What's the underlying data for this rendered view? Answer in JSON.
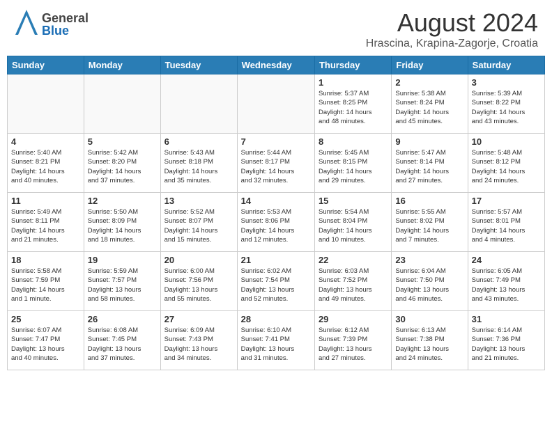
{
  "header": {
    "logo": {
      "general": "General",
      "blue": "Blue"
    },
    "title": "August 2024",
    "subtitle": "Hrascina, Krapina-Zagorje, Croatia"
  },
  "calendar": {
    "headers": [
      "Sunday",
      "Monday",
      "Tuesday",
      "Wednesday",
      "Thursday",
      "Friday",
      "Saturday"
    ],
    "rows": [
      [
        {
          "day": "",
          "info": "",
          "empty": true
        },
        {
          "day": "",
          "info": "",
          "empty": true
        },
        {
          "day": "",
          "info": "",
          "empty": true
        },
        {
          "day": "",
          "info": "",
          "empty": true
        },
        {
          "day": "1",
          "info": "Sunrise: 5:37 AM\nSunset: 8:25 PM\nDaylight: 14 hours\nand 48 minutes."
        },
        {
          "day": "2",
          "info": "Sunrise: 5:38 AM\nSunset: 8:24 PM\nDaylight: 14 hours\nand 45 minutes."
        },
        {
          "day": "3",
          "info": "Sunrise: 5:39 AM\nSunset: 8:22 PM\nDaylight: 14 hours\nand 43 minutes."
        }
      ],
      [
        {
          "day": "4",
          "info": "Sunrise: 5:40 AM\nSunset: 8:21 PM\nDaylight: 14 hours\nand 40 minutes."
        },
        {
          "day": "5",
          "info": "Sunrise: 5:42 AM\nSunset: 8:20 PM\nDaylight: 14 hours\nand 37 minutes."
        },
        {
          "day": "6",
          "info": "Sunrise: 5:43 AM\nSunset: 8:18 PM\nDaylight: 14 hours\nand 35 minutes."
        },
        {
          "day": "7",
          "info": "Sunrise: 5:44 AM\nSunset: 8:17 PM\nDaylight: 14 hours\nand 32 minutes."
        },
        {
          "day": "8",
          "info": "Sunrise: 5:45 AM\nSunset: 8:15 PM\nDaylight: 14 hours\nand 29 minutes."
        },
        {
          "day": "9",
          "info": "Sunrise: 5:47 AM\nSunset: 8:14 PM\nDaylight: 14 hours\nand 27 minutes."
        },
        {
          "day": "10",
          "info": "Sunrise: 5:48 AM\nSunset: 8:12 PM\nDaylight: 14 hours\nand 24 minutes."
        }
      ],
      [
        {
          "day": "11",
          "info": "Sunrise: 5:49 AM\nSunset: 8:11 PM\nDaylight: 14 hours\nand 21 minutes."
        },
        {
          "day": "12",
          "info": "Sunrise: 5:50 AM\nSunset: 8:09 PM\nDaylight: 14 hours\nand 18 minutes."
        },
        {
          "day": "13",
          "info": "Sunrise: 5:52 AM\nSunset: 8:07 PM\nDaylight: 14 hours\nand 15 minutes."
        },
        {
          "day": "14",
          "info": "Sunrise: 5:53 AM\nSunset: 8:06 PM\nDaylight: 14 hours\nand 12 minutes."
        },
        {
          "day": "15",
          "info": "Sunrise: 5:54 AM\nSunset: 8:04 PM\nDaylight: 14 hours\nand 10 minutes."
        },
        {
          "day": "16",
          "info": "Sunrise: 5:55 AM\nSunset: 8:02 PM\nDaylight: 14 hours\nand 7 minutes."
        },
        {
          "day": "17",
          "info": "Sunrise: 5:57 AM\nSunset: 8:01 PM\nDaylight: 14 hours\nand 4 minutes."
        }
      ],
      [
        {
          "day": "18",
          "info": "Sunrise: 5:58 AM\nSunset: 7:59 PM\nDaylight: 14 hours\nand 1 minute."
        },
        {
          "day": "19",
          "info": "Sunrise: 5:59 AM\nSunset: 7:57 PM\nDaylight: 13 hours\nand 58 minutes."
        },
        {
          "day": "20",
          "info": "Sunrise: 6:00 AM\nSunset: 7:56 PM\nDaylight: 13 hours\nand 55 minutes."
        },
        {
          "day": "21",
          "info": "Sunrise: 6:02 AM\nSunset: 7:54 PM\nDaylight: 13 hours\nand 52 minutes."
        },
        {
          "day": "22",
          "info": "Sunrise: 6:03 AM\nSunset: 7:52 PM\nDaylight: 13 hours\nand 49 minutes."
        },
        {
          "day": "23",
          "info": "Sunrise: 6:04 AM\nSunset: 7:50 PM\nDaylight: 13 hours\nand 46 minutes."
        },
        {
          "day": "24",
          "info": "Sunrise: 6:05 AM\nSunset: 7:49 PM\nDaylight: 13 hours\nand 43 minutes."
        }
      ],
      [
        {
          "day": "25",
          "info": "Sunrise: 6:07 AM\nSunset: 7:47 PM\nDaylight: 13 hours\nand 40 minutes."
        },
        {
          "day": "26",
          "info": "Sunrise: 6:08 AM\nSunset: 7:45 PM\nDaylight: 13 hours\nand 37 minutes."
        },
        {
          "day": "27",
          "info": "Sunrise: 6:09 AM\nSunset: 7:43 PM\nDaylight: 13 hours\nand 34 minutes."
        },
        {
          "day": "28",
          "info": "Sunrise: 6:10 AM\nSunset: 7:41 PM\nDaylight: 13 hours\nand 31 minutes."
        },
        {
          "day": "29",
          "info": "Sunrise: 6:12 AM\nSunset: 7:39 PM\nDaylight: 13 hours\nand 27 minutes."
        },
        {
          "day": "30",
          "info": "Sunrise: 6:13 AM\nSunset: 7:38 PM\nDaylight: 13 hours\nand 24 minutes."
        },
        {
          "day": "31",
          "info": "Sunrise: 6:14 AM\nSunset: 7:36 PM\nDaylight: 13 hours\nand 21 minutes."
        }
      ]
    ]
  }
}
